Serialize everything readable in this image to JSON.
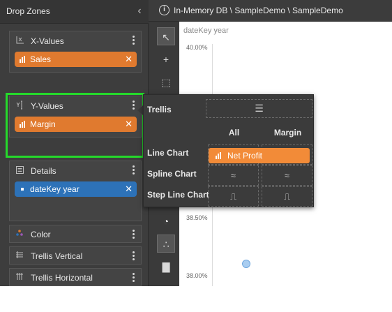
{
  "drop_zones": {
    "title": "Drop Zones",
    "collapse_glyph": "‹",
    "x_values": {
      "label": "X-Values",
      "field": "Sales"
    },
    "y_values": {
      "label": "Y-Values",
      "field": "Margin"
    },
    "details": {
      "label": "Details",
      "field": "dateKey year"
    },
    "color": {
      "label": "Color"
    },
    "trellis_vertical": {
      "label": "Trellis Vertical"
    },
    "trellis_horizontal": {
      "label": "Trellis Horizontal"
    },
    "remove_glyph": "✕"
  },
  "topbar": {
    "info_glyph": "i",
    "breadcrumb": "In-Memory DB \\ SampleDemo \\ SampleDemo"
  },
  "tools": {
    "pointer": "↖",
    "crosshair": "+",
    "select": "⬚",
    "pie": "◔",
    "scatter": "∴",
    "bars": "▇"
  },
  "chart": {
    "title": "dateKey year",
    "yticks": [
      "40.00%",
      "38.50%",
      "38.00%"
    ]
  },
  "popup": {
    "trellis_label": "Trellis",
    "columns": [
      "All",
      "Margin"
    ],
    "rows": [
      "Line Chart",
      "Spline Chart",
      "Step Line Chart"
    ],
    "net_profit": "Net Profit",
    "spline_glyph": "≈",
    "step_glyph": "⎍",
    "trellis_glyph": "☰"
  },
  "colors": {
    "accent_orange": "#e07a2f",
    "accent_blue": "#2d72b8",
    "highlight_green": "#25d92b"
  }
}
